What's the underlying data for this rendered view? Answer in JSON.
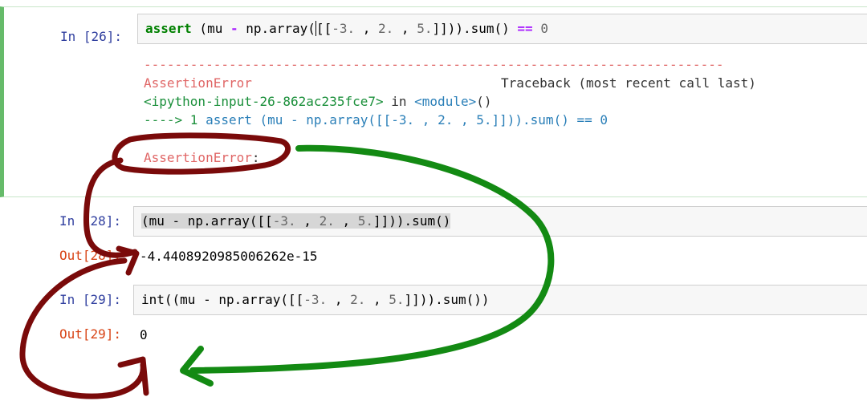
{
  "cells": {
    "c26": {
      "prompt": "In [26]:",
      "code": {
        "kw_assert": "assert",
        "p1": " (mu ",
        "minus": "-",
        "p2": " np.array(",
        "cursor": "",
        "p3": "[[",
        "n1": "-3.",
        "p4": " , ",
        "n2": "2.",
        "p5": " , ",
        "n3": "5.",
        "p6": "]])).sum() ",
        "eq": "==",
        "p7": " ",
        "n4": "0"
      },
      "traceback": {
        "dashes": "---------------------------------------------------------------------------",
        "error_name": "AssertionError",
        "traceback_header": "Traceback (most recent call last)",
        "input_ref": "<ipython-input-26-862ac235fce7>",
        "in_word": " in ",
        "module": "<module>",
        "module_paren": "()",
        "arrow": "----> 1 ",
        "arrow_code_a": "assert (mu - np.array([[",
        "arrow_n1": "-3.",
        "arrow_code_b": " , ",
        "arrow_n2": "2.",
        "arrow_code_c": " , ",
        "arrow_n3": "5.",
        "arrow_code_d": "]])).sum() == ",
        "arrow_n4": "0",
        "final_error": "AssertionError",
        "final_colon": ":"
      }
    },
    "c28": {
      "prompt_in": "In [28]:",
      "code_a": "(mu - np.array([[",
      "n1": "-3.",
      "code_b": " , ",
      "n2": "2.",
      "code_c": " , ",
      "n3": "5.",
      "code_d": "]])).sum()",
      "prompt_out": "Out[28]:",
      "output": "-4.4408920985006262e-15"
    },
    "c29": {
      "prompt_in": "In [29]:",
      "code_a": "int((mu - np.array([[",
      "n1": "-3.",
      "code_b": " , ",
      "n2": "2.",
      "code_c": " , ",
      "n3": "5.",
      "code_d": "]])).sum())",
      "prompt_out": "Out[29]:",
      "output": "0"
    }
  },
  "annotation_colors": {
    "red_marker": "#7a0a0a",
    "green_marker": "#138a13",
    "cell_selected_bar": "#66bb6a"
  }
}
